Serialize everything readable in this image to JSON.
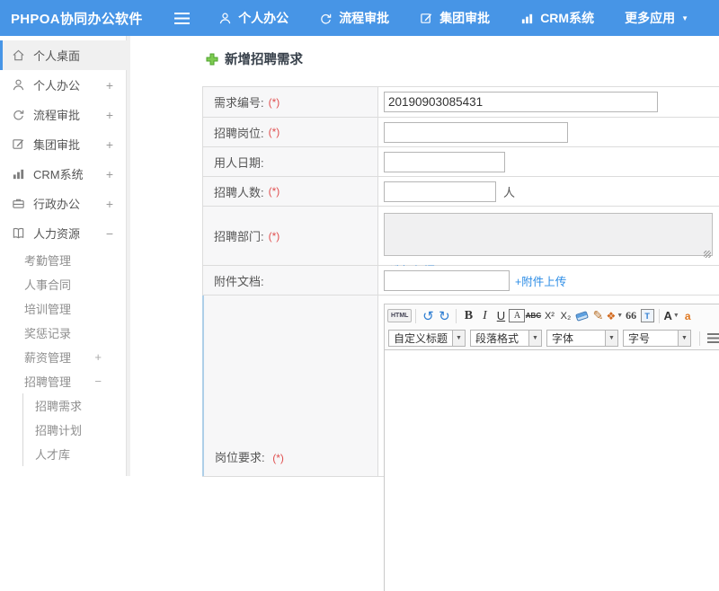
{
  "topbar": {
    "logo": "PHPOA协同办公软件",
    "nav": [
      {
        "label": "个人办公"
      },
      {
        "label": "流程审批"
      },
      {
        "label": "集团审批"
      },
      {
        "label": "CRM系统"
      },
      {
        "label": "更多应用"
      }
    ]
  },
  "sidebar": {
    "items": [
      {
        "label": "个人桌面"
      },
      {
        "label": "个人办公",
        "expand": "+"
      },
      {
        "label": "流程审批",
        "expand": "+"
      },
      {
        "label": "集团审批",
        "expand": "+"
      },
      {
        "label": "CRM系统",
        "expand": "+"
      },
      {
        "label": "行政办公",
        "expand": "+"
      },
      {
        "label": "人力资源",
        "expand": "−"
      }
    ],
    "hr_children": [
      {
        "label": "考勤管理"
      },
      {
        "label": "人事合同"
      },
      {
        "label": "培训管理"
      },
      {
        "label": "奖惩记录"
      },
      {
        "label": "薪资管理",
        "expand": "+"
      },
      {
        "label": "招聘管理",
        "expand": "−"
      }
    ],
    "recruit_children": [
      {
        "label": "招聘需求"
      },
      {
        "label": "招聘计划"
      },
      {
        "label": "人才库"
      }
    ]
  },
  "main": {
    "title": "新增招聘需求",
    "form": {
      "rows": {
        "req_no": {
          "label": "需求编号:",
          "required": "(*)",
          "value": "20190903085431"
        },
        "position": {
          "label": "招聘岗位:",
          "required": "(*)"
        },
        "hire_date": {
          "label": "用人日期:"
        },
        "headcount": {
          "label": "招聘人数:",
          "required": "(*)",
          "suffix": "人"
        },
        "department": {
          "label": "招聘部门:",
          "required": "(*)",
          "link": "+选择部门"
        },
        "attachment": {
          "label": "附件文档:",
          "link": "+附件上传"
        },
        "requirements": {
          "label": "岗位要求:",
          "required": "(*)"
        }
      }
    },
    "editor": {
      "html_button": "HTML",
      "bold": "B",
      "italic": "I",
      "underline": "U",
      "box_a": "A",
      "strike": "ABC",
      "superscript": "X²",
      "subscript": "X₂",
      "quote": "66",
      "paste": "T",
      "font_color": "A",
      "back_color": "a",
      "selects": {
        "heading": "自定义标题",
        "paragraph": "段落格式",
        "font_family": "字体",
        "font_size": "字号"
      }
    }
  },
  "icons": {
    "caret_down": "▼",
    "select_caret": "▼",
    "undo": "↺",
    "redo": "↻",
    "palette": "❖"
  },
  "colors": {
    "topbar_blue": "#4795e6",
    "link_blue": "#2b8ce6",
    "required_red": "#e05050",
    "active_border_blue": "#4795e6",
    "row_highlight_blue": "#aecfe8",
    "title_icon_green": "#6abf45"
  }
}
